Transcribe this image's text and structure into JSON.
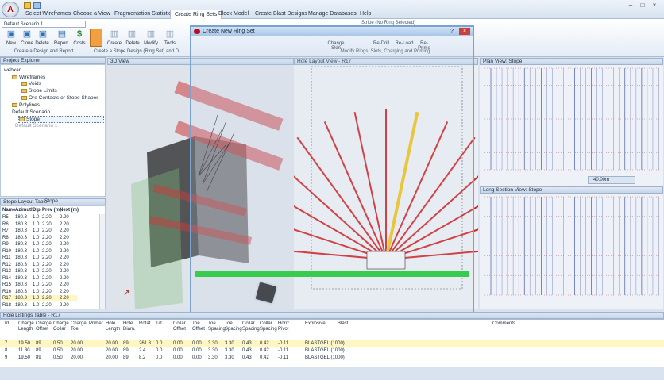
{
  "app": {
    "logo_letter": "A",
    "menu": [
      "Select Wireframes",
      "Choose a View",
      "Fragmentation Statistics",
      "Create Ring Sets",
      "Block Model",
      "Create Blast Designs",
      "Manage Databases",
      "Help"
    ],
    "active_menu_index": 3,
    "window_buttons": [
      "–",
      "□",
      "×"
    ]
  },
  "ribbon": {
    "scenario": "Default Scenario 1",
    "buttons_left": [
      "New",
      "Clone",
      "Delete",
      "Report",
      "Costs"
    ],
    "group_left": "Create a Design and Report",
    "buttons_mid": [
      "Create",
      "Delete",
      "Modify",
      "Tools"
    ],
    "group_mid": "Create a Stope Design (Ring Set) and D",
    "buttons_right": [
      "Change Skin",
      "Re-Drill",
      "Re-Load",
      "Re-Prime"
    ],
    "group_right": "Modify Rings, Slots, Charging and Priming",
    "note": "Stripe (No Ring Selected)"
  },
  "project_explorer": {
    "title": "Project Explorer",
    "items": [
      {
        "label": "webxar",
        "level": 0
      },
      {
        "label": "Wireframes",
        "level": 1
      },
      {
        "label": "Voids",
        "level": 2
      },
      {
        "label": "Stope Limits",
        "level": 2
      },
      {
        "label": "Ore Contacts or Stope Shapes",
        "level": 2
      },
      {
        "label": "Polylines",
        "level": 1
      },
      {
        "label": "Default Scenario",
        "level": 1
      },
      {
        "label": "Stope",
        "level": 2
      },
      {
        "label": "Default Scenario 1",
        "level": 1
      }
    ]
  },
  "stope_table": {
    "title": "Stope Layout Table",
    "tab": "Stope",
    "columns": [
      "Name",
      "Azimuth",
      "Dip",
      "Prev (m)",
      "Next (m)"
    ],
    "rows": [
      [
        "R5",
        "180.3",
        "1.0",
        "2.20",
        "2.20"
      ],
      [
        "R6",
        "180.3",
        "1.0",
        "2.20",
        "2.20"
      ],
      [
        "R7",
        "180.3",
        "1.0",
        "2.20",
        "2.20"
      ],
      [
        "R8",
        "180.3",
        "1.0",
        "2.20",
        "2.20"
      ],
      [
        "R9",
        "180.3",
        "1.0",
        "2.20",
        "2.20"
      ],
      [
        "R10",
        "180.3",
        "1.0",
        "2.20",
        "2.20"
      ],
      [
        "R11",
        "180.3",
        "1.0",
        "2.20",
        "2.20"
      ],
      [
        "R12",
        "180.3",
        "1.0",
        "2.20",
        "2.20"
      ],
      [
        "R13",
        "180.3",
        "1.0",
        "2.20",
        "2.20"
      ],
      [
        "R14",
        "180.3",
        "1.0",
        "2.20",
        "2.20"
      ],
      [
        "R15",
        "180.3",
        "1.0",
        "2.20",
        "2.20"
      ],
      [
        "R16",
        "180.3",
        "1.0",
        "2.20",
        "2.20"
      ],
      [
        "R17",
        "180.3",
        "1.0",
        "2.20",
        "2.20"
      ],
      [
        "R18",
        "180.3",
        "1.0",
        "2.20",
        "2.20"
      ]
    ],
    "selected_row": 12
  },
  "views": {
    "view3d_title": "3D View",
    "ring_title": "Hole Layout View - R17",
    "plan_title": "Plan View: Stope",
    "long_title": "Long Section View: Stope",
    "plan_zoom": "40.00m"
  },
  "dialog": {
    "title": "Create New Ring Set",
    "help": "?",
    "close": "×"
  },
  "hole_table": {
    "title": "Hole Listings Table - R17",
    "columns": [
      "Id",
      "Charge Length",
      "Charge Offset",
      "Charge Collar",
      "Charge Toe",
      "Primer",
      "Hole Length",
      "Hole Diam.",
      "Rotat.",
      "Tilt",
      "Collar Offset",
      "Toe Offset",
      "Toe Spacing",
      "Toe Spacing",
      "Collar Spacing",
      "Collar Spacing",
      "Horiz. Pivot",
      "Explosive",
      "Blast",
      "Comments"
    ],
    "rows": [
      [
        "7",
        "19.50",
        "89",
        "0.50",
        "20.00",
        "",
        "20.00",
        "89",
        "261.8",
        "0.0",
        "0.00",
        "0.00",
        "3.30",
        "3.30",
        "0.43",
        "0.42",
        "-0.11",
        "BLASTGEL (1000)",
        "",
        ""
      ],
      [
        "8",
        "11.30",
        "89",
        "0.50",
        "20.00",
        "",
        "20.00",
        "89",
        "2.4",
        "0.0",
        "0.00",
        "0.00",
        "3.30",
        "3.30",
        "0.43",
        "0.42",
        "-0.11",
        "BLASTGEL (1000)",
        "",
        ""
      ],
      [
        "9",
        "19.50",
        "89",
        "0.50",
        "20.00",
        "",
        "20.00",
        "89",
        "8.2",
        "0.0",
        "0.00",
        "0.00",
        "3.30",
        "3.30",
        "0.43",
        "0.42",
        "-0.11",
        "BLASTGEL (1000)",
        "",
        ""
      ]
    ],
    "selected_row": 0
  },
  "colors": {
    "ring_hole": "#d42121",
    "selected_hole": "#f0c418",
    "drive_bar": "#19c82a",
    "selection": "#fff6c2"
  }
}
